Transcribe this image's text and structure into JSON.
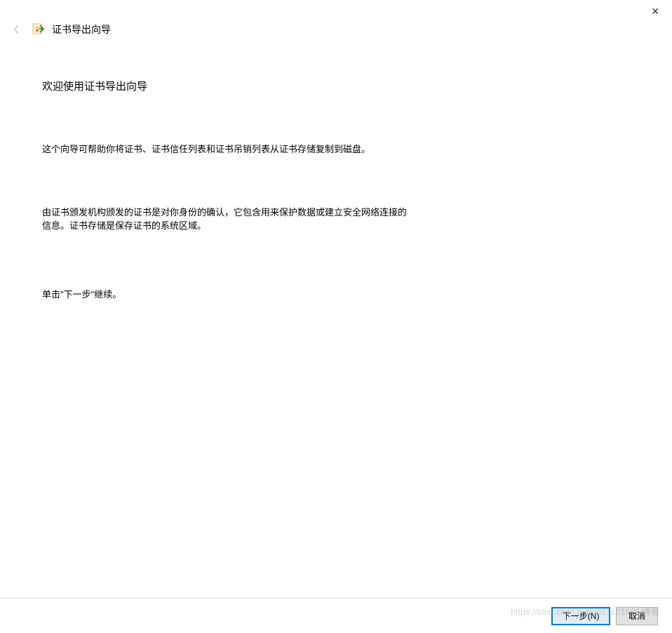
{
  "window": {
    "title": "证书导出向导"
  },
  "content": {
    "welcome": "欢迎使用证书导出向导",
    "para1": "这个向导可帮助你将证书、证书信任列表和证书吊销列表从证书存储复制到磁盘。",
    "para2": "由证书颁发机构颁发的证书是对你身份的确认，它包含用来保护数据或建立安全网络连接的信息。证书存储是保存证书的系统区域。",
    "para3": "单击\"下一步\"继续。"
  },
  "buttons": {
    "next": "下一步(N)",
    "cancel": "取消"
  },
  "watermark": "https://blog.csdn.net/u013171526/博客"
}
